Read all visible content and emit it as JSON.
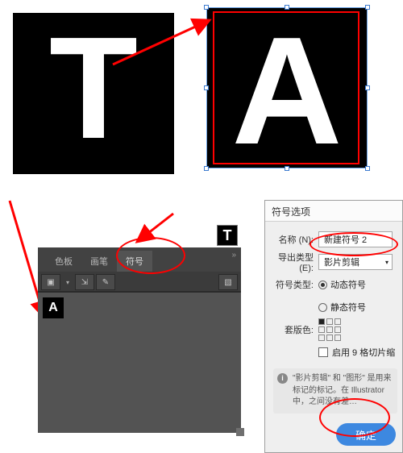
{
  "tiles": {
    "tLetter": "T",
    "aLetter": "A"
  },
  "panel": {
    "tabs": {
      "swatches": "色板",
      "brushes": "画笔",
      "symbols": "符号"
    },
    "symbolItems": {
      "t": "T",
      "a": "A"
    },
    "controls": "»"
  },
  "dialog": {
    "title": "符号选项",
    "nameLabel": "名称 (N):",
    "nameValue": "新建符号 2",
    "exportTypeLabel": "导出类型 (E):",
    "exportTypeValue": "影片剪辑",
    "symbolTypeLabel": "符号类型:",
    "dynamicSymbol": "动态符号",
    "staticSymbol": "静态符号",
    "registrationLabel": "套版色:",
    "enableNineSlice": "启用 9 格切片缩",
    "infoText": "\"影片剪辑\" 和 \"图形\" 是用来标记的标记。在 Illustrator 中，之间没有差…",
    "okLabel": "确定"
  }
}
